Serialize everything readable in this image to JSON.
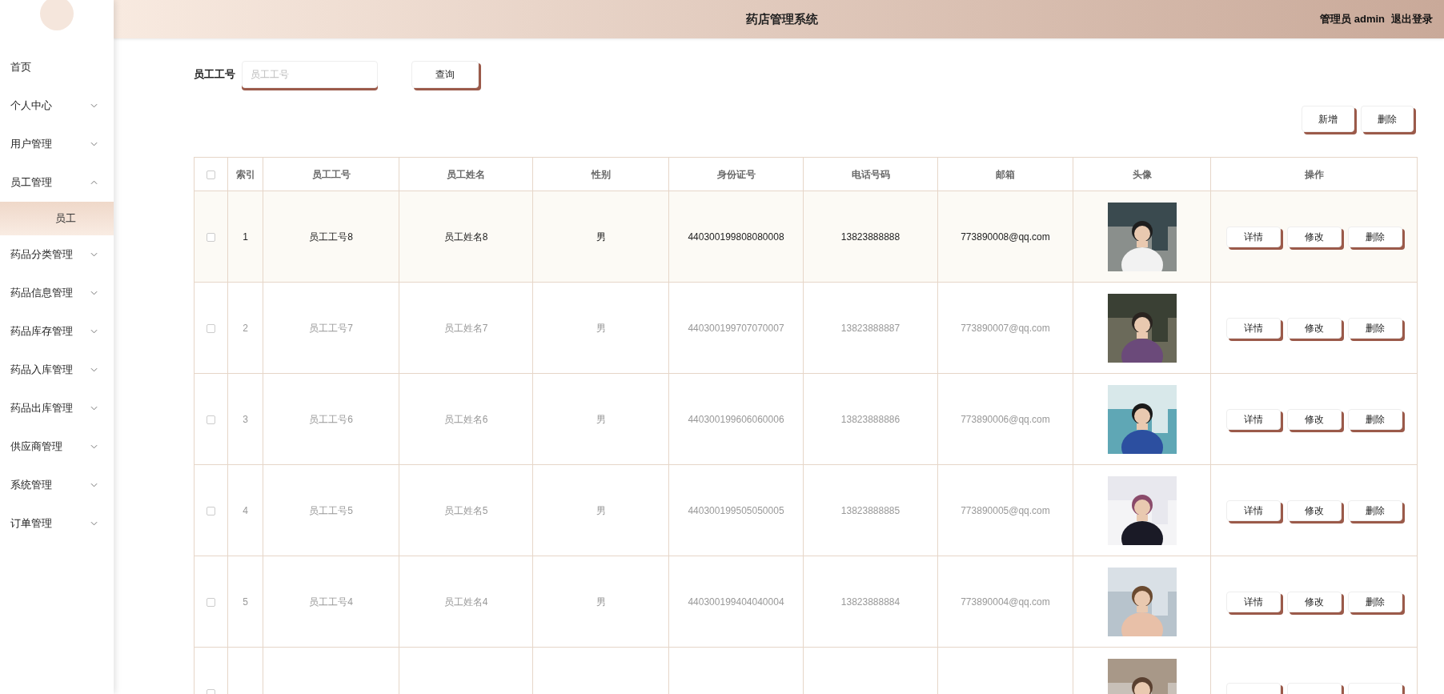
{
  "header": {
    "title": "药店管理系统",
    "user": "管理员 admin",
    "logout": "退出登录"
  },
  "sidebar": {
    "items": [
      {
        "label": "首页",
        "kind": "link"
      },
      {
        "label": "个人中心",
        "kind": "group",
        "expanded": false
      },
      {
        "label": "用户管理",
        "kind": "group",
        "expanded": false
      },
      {
        "label": "员工管理",
        "kind": "group",
        "expanded": true,
        "children": [
          {
            "label": "员工",
            "selected": true
          }
        ]
      },
      {
        "label": "药品分类管理",
        "kind": "group",
        "expanded": false
      },
      {
        "label": "药品信息管理",
        "kind": "group",
        "expanded": false
      },
      {
        "label": "药品库存管理",
        "kind": "group",
        "expanded": false
      },
      {
        "label": "药品入库管理",
        "kind": "group",
        "expanded": false
      },
      {
        "label": "药品出库管理",
        "kind": "group",
        "expanded": false
      },
      {
        "label": "供应商管理",
        "kind": "group",
        "expanded": false
      },
      {
        "label": "系统管理",
        "kind": "group",
        "expanded": false
      },
      {
        "label": "订单管理",
        "kind": "group",
        "expanded": false
      }
    ]
  },
  "search": {
    "label": "员工工号",
    "placeholder": "员工工号",
    "button": "查询"
  },
  "actions": [
    "新增",
    "删除"
  ],
  "table": {
    "select_all": {
      "checked": false
    },
    "columns": [
      "索引",
      "员工工号",
      "员工姓名",
      "性别",
      "身份证号",
      "电话号码",
      "邮箱",
      "头像",
      "操作"
    ],
    "rows": [
      {
        "index": "1",
        "id": "员工工号8",
        "name": "员工姓名8",
        "gender": "男",
        "id_card": "440300199808080008",
        "phone": "13823888888",
        "email": "773890008@qq.com",
        "highlighted": true,
        "checked": false,
        "buttons": [
          "详情",
          "修改",
          "删除"
        ]
      },
      {
        "index": "2",
        "id": "员工工号7",
        "name": "员工姓名7",
        "gender": "男",
        "id_card": "440300199707070007",
        "phone": "13823888887",
        "email": "773890007@qq.com",
        "highlighted": false,
        "checked": false,
        "buttons": [
          "详情",
          "修改",
          "删除"
        ]
      },
      {
        "index": "3",
        "id": "员工工号6",
        "name": "员工姓名6",
        "gender": "男",
        "id_card": "440300199606060006",
        "phone": "13823888886",
        "email": "773890006@qq.com",
        "highlighted": false,
        "checked": false,
        "buttons": [
          "详情",
          "修改",
          "删除"
        ]
      },
      {
        "index": "4",
        "id": "员工工号5",
        "name": "员工姓名5",
        "gender": "男",
        "id_card": "440300199505050005",
        "phone": "13823888885",
        "email": "773890005@qq.com",
        "highlighted": false,
        "checked": false,
        "buttons": [
          "详情",
          "修改",
          "删除"
        ]
      },
      {
        "index": "5",
        "id": "员工工号4",
        "name": "员工姓名4",
        "gender": "男",
        "id_card": "440300199404040004",
        "phone": "13823888884",
        "email": "773890004@qq.com",
        "highlighted": false,
        "checked": false,
        "buttons": [
          "详情",
          "修改",
          "删除"
        ]
      },
      {
        "kind": "cut",
        "checked": false
      }
    ]
  }
}
